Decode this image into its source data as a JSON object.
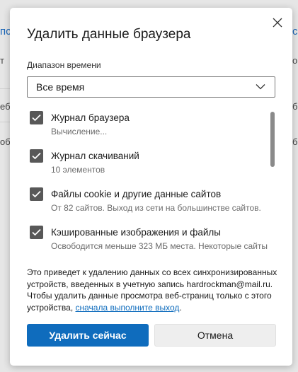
{
  "background": {
    "fragments": [
      "пс",
      "т",
      "еб",
      "об",
      "с",
      "о",
      "б",
      "б"
    ]
  },
  "dialog": {
    "title": "Удалить данные браузера",
    "close_icon": "close-icon",
    "time_range": {
      "label": "Диапазон времени",
      "selected": "Все время"
    },
    "options": [
      {
        "label": "Журнал браузера",
        "description": "Вычисление...",
        "checked": true
      },
      {
        "label": "Журнал скачиваний",
        "description": "10 элементов",
        "checked": true
      },
      {
        "label": "Файлы cookie и другие данные сайтов",
        "description": "От 82 сайтов. Выход из сети на большинстве сайтов.",
        "checked": true
      },
      {
        "label": "Кэшированные изображения и файлы",
        "description": "Освободится меньше 323 МБ места. Некоторые сайты",
        "checked": true
      }
    ],
    "info_text": "Это приведет к удалению данных со всех синхронизированных устройств, введенных в учетную запись hardrockman@mail.ru. Чтобы удалить данные просмотра веб-страниц только с этого устройства, ",
    "info_link": "сначала выполните выход",
    "info_end": ".",
    "buttons": {
      "clear_now": "Удалить сейчас",
      "cancel": "Отмена"
    }
  },
  "colors": {
    "accent": "#0f6cbd",
    "checkbox": "#585858"
  }
}
